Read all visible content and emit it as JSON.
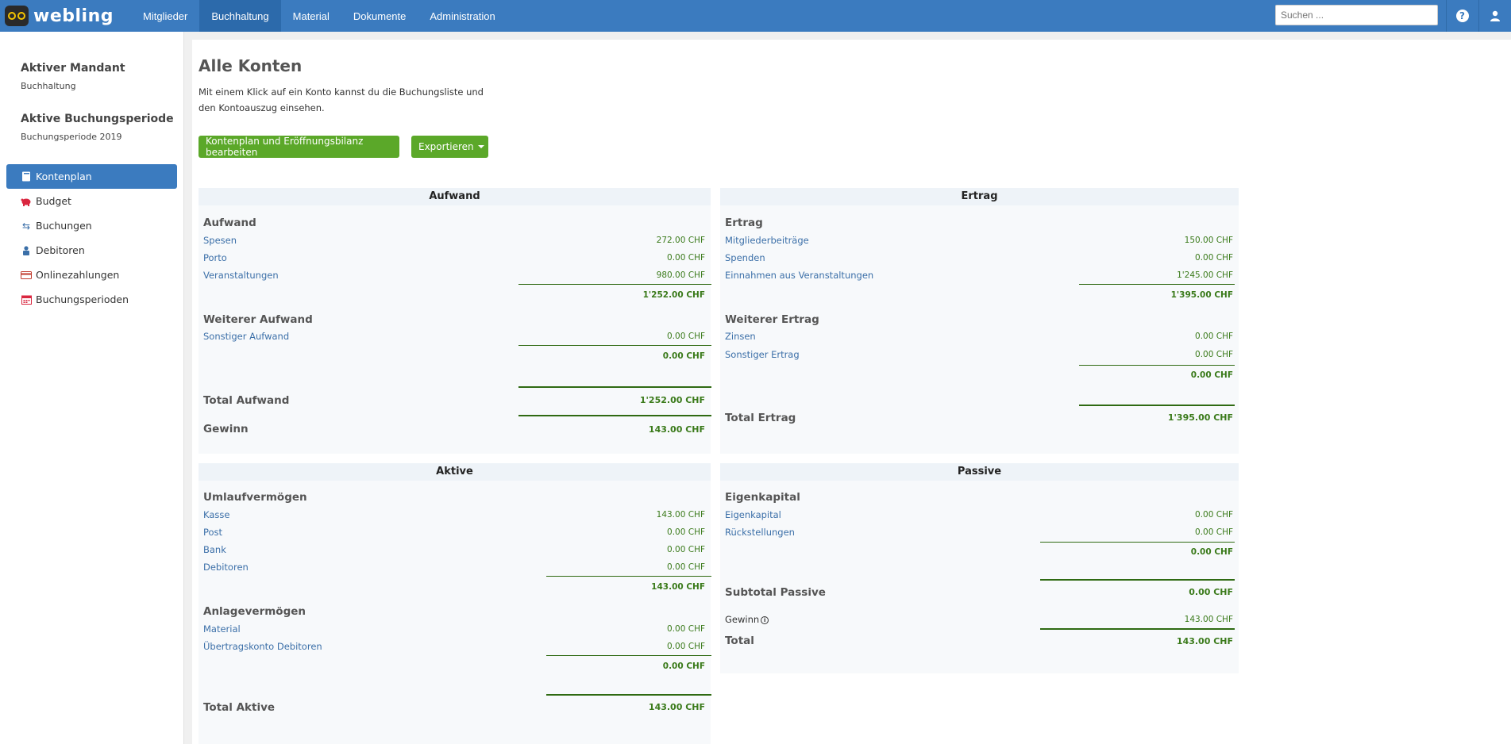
{
  "app": {
    "logo_text": "webling"
  },
  "nav": {
    "items": [
      "Mitglieder",
      "Buchhaltung",
      "Material",
      "Dokumente",
      "Administration"
    ],
    "active": "Buchhaltung"
  },
  "search": {
    "placeholder": "Suchen ..."
  },
  "sidebar": {
    "mandant_title": "Aktiver Mandant",
    "mandant_value": "Buchhaltung",
    "periode_title": "Aktive Buchungsperiode",
    "periode_value": "Buchungsperiode 2019",
    "menu": [
      {
        "label": "Kontenplan",
        "icon": "book-icon",
        "active": true
      },
      {
        "label": "Budget",
        "icon": "piggy-bank-icon"
      },
      {
        "label": "Buchungen",
        "icon": "exchange-icon"
      },
      {
        "label": "Debitoren",
        "icon": "person-icon"
      },
      {
        "label": "Onlinezahlungen",
        "icon": "credit-card-icon"
      },
      {
        "label": "Buchungsperioden",
        "icon": "calendar-icon"
      }
    ]
  },
  "main": {
    "title": "Alle Konten",
    "description": "Mit einem Klick auf ein Konto kannst du die Buchungsliste und den Kontoauszug einsehen.",
    "btn_edit": "Kontenplan und Eröffnungsbilanz bearbeiten",
    "btn_export": "Exportieren"
  },
  "aufwand": {
    "header": "Aufwand",
    "group1": {
      "title": "Aufwand",
      "rows": [
        {
          "name": "Spesen",
          "value": "272.00 CHF"
        },
        {
          "name": "Porto",
          "value": "0.00 CHF"
        },
        {
          "name": "Veranstaltungen",
          "value": "980.00 CHF"
        }
      ],
      "sum": "1'252.00 CHF"
    },
    "group2": {
      "title": "Weiterer Aufwand",
      "rows": [
        {
          "name": "Sonstiger Aufwand",
          "value": "0.00 CHF"
        }
      ],
      "sum": "0.00 CHF"
    },
    "total_label": "Total Aufwand",
    "total_value": "1'252.00 CHF",
    "gewinn_label": "Gewinn",
    "gewinn_value": "143.00 CHF"
  },
  "ertrag": {
    "header": "Ertrag",
    "group1": {
      "title": "Ertrag",
      "rows": [
        {
          "name": "Mitgliederbeiträge",
          "value": "150.00 CHF"
        },
        {
          "name": "Spenden",
          "value": "0.00 CHF"
        },
        {
          "name": "Einnahmen aus Veranstaltungen",
          "value": "1'245.00 CHF"
        }
      ],
      "sum": "1'395.00 CHF"
    },
    "group2": {
      "title": "Weiterer Ertrag",
      "rows": [
        {
          "name": "Zinsen",
          "value": "0.00 CHF"
        },
        {
          "name": "Sonstiger Ertrag",
          "value": "0.00 CHF"
        }
      ],
      "sum": "0.00 CHF"
    },
    "total_label": "Total Ertrag",
    "total_value": "1'395.00 CHF"
  },
  "aktive": {
    "header": "Aktive",
    "group1": {
      "title": "Umlaufvermögen",
      "rows": [
        {
          "name": "Kasse",
          "value": "143.00 CHF"
        },
        {
          "name": "Post",
          "value": "0.00 CHF"
        },
        {
          "name": "Bank",
          "value": "0.00 CHF"
        },
        {
          "name": "Debitoren",
          "value": "0.00 CHF"
        }
      ],
      "sum": "143.00 CHF"
    },
    "group2": {
      "title": "Anlagevermögen",
      "rows": [
        {
          "name": "Material",
          "value": "0.00 CHF"
        },
        {
          "name": "Übertragskonto Debitoren",
          "value": "0.00 CHF"
        }
      ],
      "sum": "0.00 CHF"
    },
    "total_label": "Total Aktive",
    "total_value": "143.00 CHF"
  },
  "passive": {
    "header": "Passive",
    "group1": {
      "title": "Eigenkapital",
      "rows": [
        {
          "name": "Eigenkapital",
          "value": "0.00 CHF"
        },
        {
          "name": "Rückstellungen",
          "value": "0.00 CHF"
        }
      ],
      "sum": "0.00 CHF"
    },
    "subtotal_label": "Subtotal Passive",
    "subtotal_value": "0.00 CHF",
    "gewinn_label": "Gewinn",
    "gewinn_value": "143.00 CHF",
    "total_label": "Total",
    "total_value": "143.00 CHF"
  },
  "colors": {
    "topbar": "#3b7bbf",
    "button_green": "#5ba829",
    "value_green": "#3a7a1a",
    "link_blue": "#3b6fa8"
  }
}
